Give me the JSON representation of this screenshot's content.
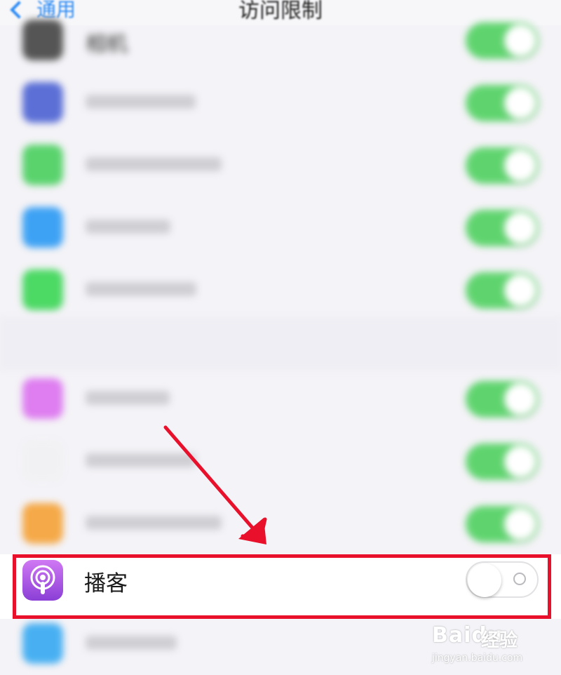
{
  "nav": {
    "back_label": "通用",
    "title": "访问限制"
  },
  "rows_above": [
    {
      "label": "相机",
      "icon_color": "#555555",
      "on": true
    },
    {
      "label": "",
      "icon_color": "#5b6fd6",
      "on": true
    },
    {
      "label": "",
      "icon_color": "#5ad36d",
      "on": true
    },
    {
      "label": "",
      "icon_color": "#3ea2f4",
      "on": true
    },
    {
      "label": "",
      "icon_color": "#4cd964",
      "on": true
    }
  ],
  "rows_below": [
    {
      "label": "",
      "icon_color": "#de7ef0",
      "on": true
    },
    {
      "label": "",
      "icon_color": "#f1f1f3",
      "on": true
    },
    {
      "label": "",
      "icon_color": "#f5a948",
      "on": true
    }
  ],
  "podcast_row": {
    "label": "播客",
    "icon": "podcast-icon",
    "on": false
  },
  "bottom_row": {
    "label": "",
    "icon_color": "#48b0f2"
  },
  "watermark": {
    "brand": "Bai",
    "brand2": "du",
    "sub": "经验",
    "url": "jingyan.baidu.com"
  },
  "colors": {
    "toggle_on": "#5fd46e",
    "highlight": "#e8102a",
    "accent": "#2f8cf4"
  }
}
